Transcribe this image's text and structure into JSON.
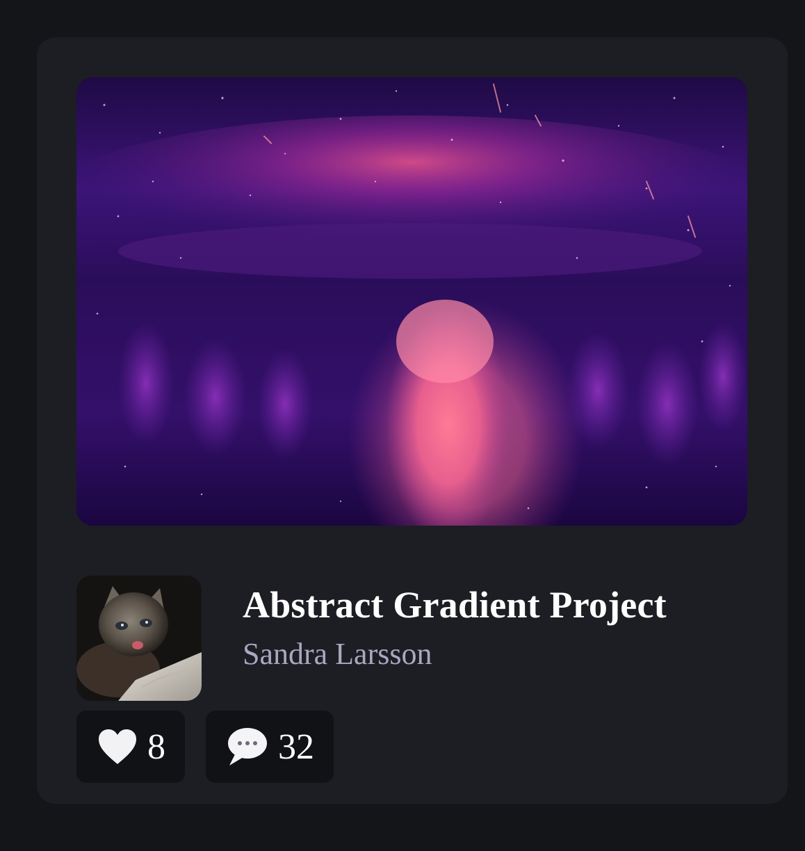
{
  "project": {
    "title": "Abstract Gradient Project",
    "author": "Sandra Larsson",
    "cover_image": "abstract-purple-pink-nebula",
    "avatar_image": "kitten-photo"
  },
  "stats": {
    "likes": {
      "icon": "heart-icon",
      "count": "8"
    },
    "comments": {
      "icon": "speech-bubble-icon",
      "count": "32"
    }
  },
  "colors": {
    "page_background": "#141518",
    "card_background": "#1d1d24",
    "stat_background": "#111215",
    "title": "#ffffff",
    "author": "#a8a9c0"
  }
}
